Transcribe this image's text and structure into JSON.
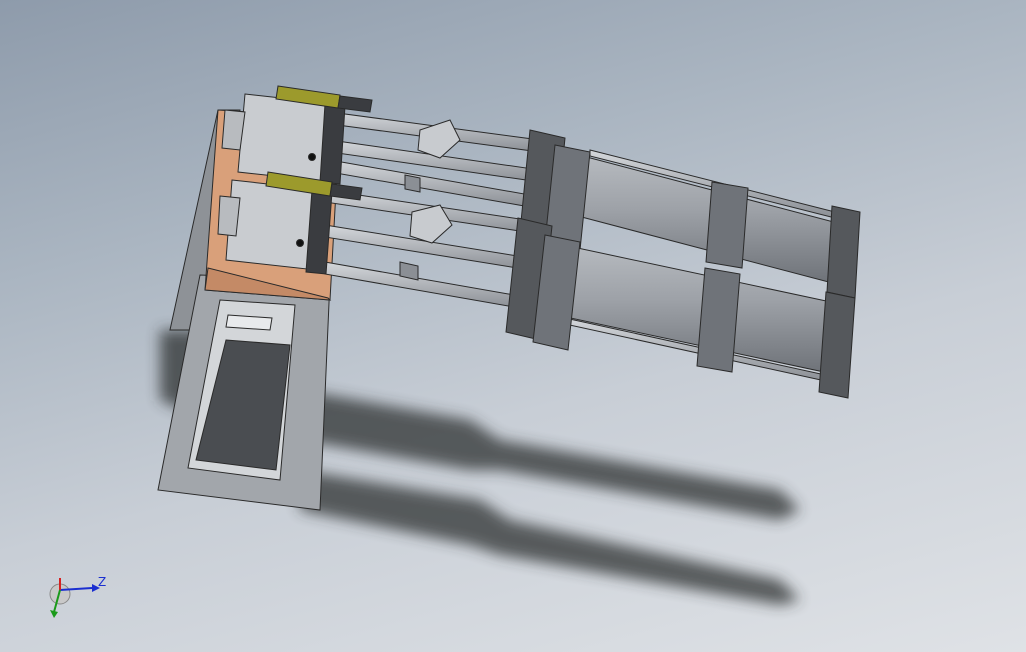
{
  "viewport": {
    "background_top": "#8e9bab",
    "background_bottom": "#dfe2e6"
  },
  "model": {
    "parts": [
      "base-plate",
      "upright-frame",
      "gripper-block-upper",
      "gripper-block-lower",
      "rod-assembly-upper",
      "rod-assembly-lower",
      "cylinder-upper",
      "cylinder-lower"
    ],
    "colors": {
      "steel": "#9a9ea4",
      "steel_dark": "#6f7379",
      "copper_plate": "#d9a07a",
      "brass_fitting": "#9c9a2c",
      "flange": "#55585c",
      "shadow": "#2e3033"
    }
  },
  "triad": {
    "z_label": "Z",
    "x_color": "#d62020",
    "y_color": "#1a9a1a",
    "z_color": "#1b2fd0"
  }
}
